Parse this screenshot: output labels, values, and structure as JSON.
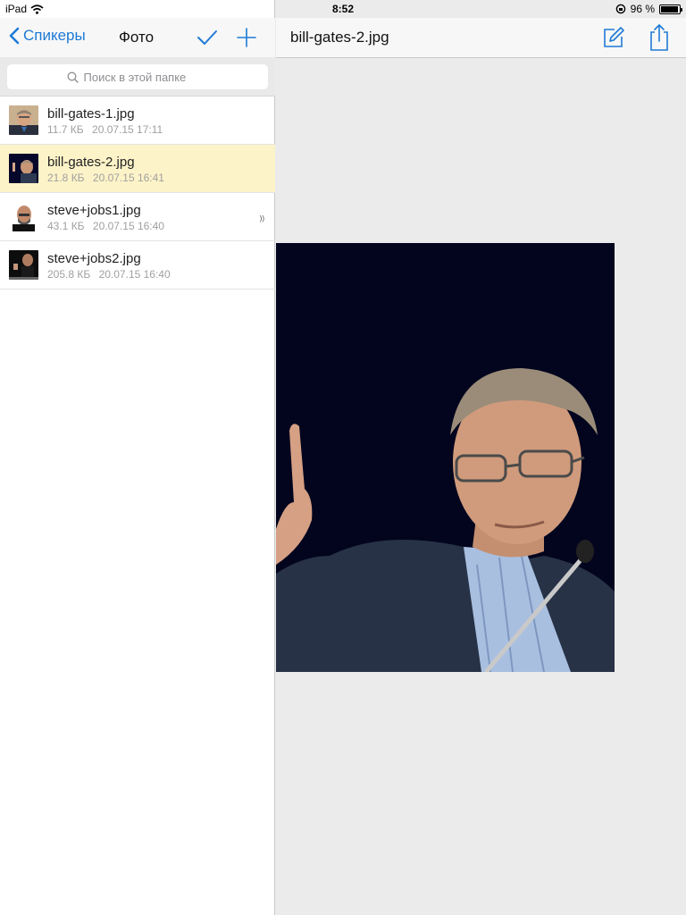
{
  "status_bar": {
    "device": "iPad",
    "time": "8:52",
    "battery_percent": "96 %",
    "battery_level": 0.96
  },
  "left_nav": {
    "back_label": "Спикеры",
    "title": "Фото"
  },
  "search": {
    "placeholder": "Поиск в этой папке"
  },
  "files": [
    {
      "name": "bill-gates-1.jpg",
      "size": "11.7 КБ",
      "date": "20.07.15 17:11",
      "selected": false
    },
    {
      "name": "bill-gates-2.jpg",
      "size": "21.8 КБ",
      "date": "20.07.15 16:41",
      "selected": true
    },
    {
      "name": "steve+jobs1.jpg",
      "size": "43.1 КБ",
      "date": "20.07.15 16:40",
      "selected": false
    },
    {
      "name": "steve+jobs2.jpg",
      "size": "205.8 КБ",
      "date": "20.07.15 16:40",
      "selected": false
    }
  ],
  "right_nav": {
    "title": "bill-gates-2.jpg"
  },
  "colors": {
    "accent": "#1e7ad6",
    "selected_row": "#fdf3c8",
    "preview_bg": "#03051e"
  },
  "icons": {
    "back": "chevron-left-icon",
    "check": "checkmark-icon",
    "add": "plus-icon",
    "search": "search-icon",
    "edit": "edit-icon",
    "share": "share-icon"
  }
}
